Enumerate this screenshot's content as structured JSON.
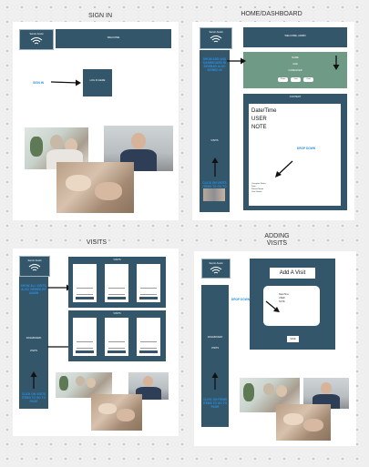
{
  "frames": {
    "signin": {
      "title": "SIGN IN",
      "logo_text": "Senior Assist",
      "welcome": "WELCOME",
      "sign_in_label": "SIGN IN",
      "login_box": "LOG IN HERE"
    },
    "home": {
      "title": "HOME/DASHBOARD",
      "logo_text": "Senior Assist",
      "welcome": "WELCOME, ADMIN",
      "side_note": "SHOW ADD AND DASHBOARD IN SIDEBAR ALSO SIGNED IN",
      "visit_label": "VISITS",
      "side_bottom_note": "CLICK ON VISITS ITEMS TO GO TO PAGE",
      "green_lines": [
        "NAME",
        "AGE",
        "CAREGIVER"
      ],
      "pills": [
        "Plans",
        "Visit",
        "Chat"
      ],
      "card_header": "CONTENT",
      "note_fields": [
        "Date/Time",
        "USER",
        "NOTE"
      ],
      "dropdown_label": "DROP DOWN",
      "dropdown_items": [
        "Caregiver Notes",
        "Date",
        "Patient Name",
        "Visit Details"
      ]
    },
    "visits": {
      "title": "VISITS",
      "logo_text": "Senior Assist",
      "side_note": "SHOW ALL VISITS, ALSO VIEWED BY ADMIN",
      "side_item_1": "DASHBOARD",
      "side_item_2": "VISITS",
      "side_bottom_note": "CLICK ON VISITS ITEMS TO GO TO PAGE",
      "row_headers": [
        "VISITS",
        "VISITS"
      ]
    },
    "adding": {
      "title": "ADDING VISITS",
      "logo_text": "Senior Assist",
      "dropdown_note": "DROP DOWN",
      "side_item_1": "DASHBOARD",
      "side_item_2": "VISITS",
      "side_bottom_note": "CLICK ON ITEMS ITEMS TO GO TO PAGE",
      "add_button": "Add A Visit",
      "form_lines": [
        "Date/Time",
        "USER",
        "NOTE"
      ],
      "save_button": "SAVE"
    }
  },
  "colors": {
    "teal": "#34566a",
    "green": "#6f9a86",
    "link_blue": "#2a8fe0",
    "canvas": "#efefef"
  }
}
